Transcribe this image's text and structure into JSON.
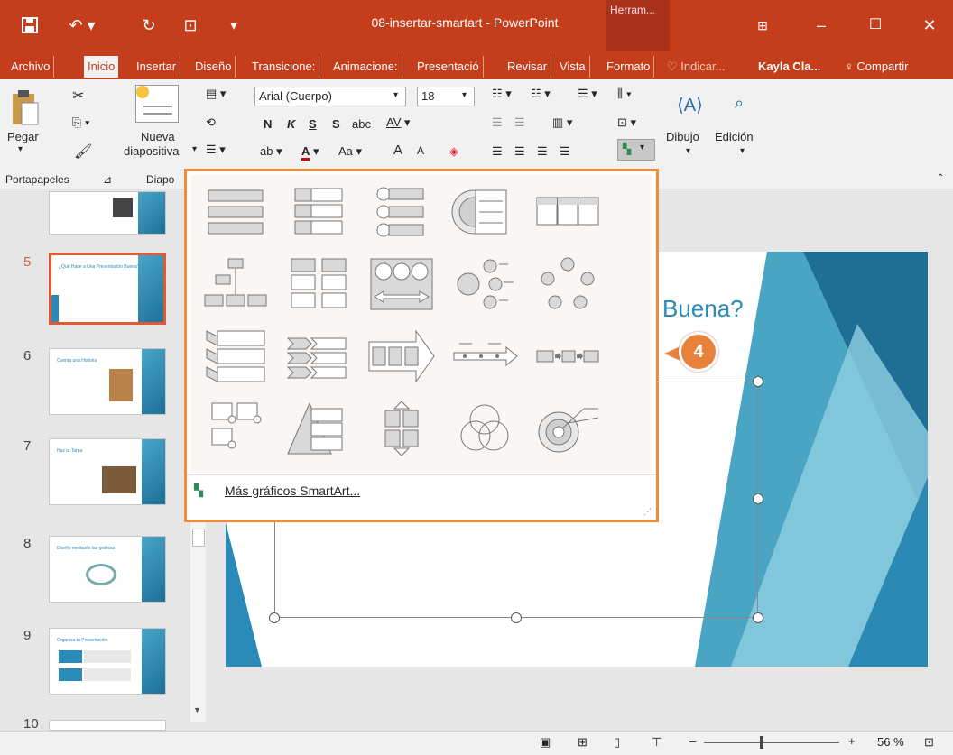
{
  "titlebar": {
    "title": "08-insertar-smartart  -  PowerPoint",
    "contextual_tab": "Herram...",
    "icons": [
      "save-icon",
      "undo-icon",
      "redo-icon",
      "start-presentation-icon",
      "customize-icon",
      "ribbon-display-icon",
      "minimize-icon",
      "maximize-icon",
      "close-icon"
    ]
  },
  "tabs": [
    "Archivo",
    "Inicio",
    "Insertar",
    "Diseño",
    "Transicione:",
    "Animacione:",
    "Presentació",
    "Revisar",
    "Vista",
    "Formato"
  ],
  "tabs_active": "Inicio",
  "tell_me": "Indicar...",
  "user": "Kayla Cla...",
  "share": "Compartir",
  "ribbon": {
    "paste": "Pegar",
    "new_slide_1": "Nueva",
    "new_slide_2": "diapositiva",
    "font_name": "Arial (Cuerpo)",
    "font_size": "18",
    "bold": "N",
    "italic": "K",
    "underline": "S",
    "shadow": "S",
    "strike": "abc",
    "spacing": "AV",
    "font_color": "A",
    "case": "Aa",
    "grow": "A",
    "shrink": "A",
    "draw": "Dibujo",
    "edit": "Edición",
    "group_clipboard": "Portapapeles",
    "group_slides": "Diapo"
  },
  "slides": [
    {
      "num": "5",
      "title": "¿Qué Hace a Una Presentación Buena?",
      "selected": true
    },
    {
      "num": "6",
      "title": "Cuenta una Historia"
    },
    {
      "num": "7",
      "title": "Haz tu Tarea"
    },
    {
      "num": "8",
      "title": "Diseño mediante las gráficas"
    },
    {
      "num": "9",
      "title": "Organiza tu Presentación"
    },
    {
      "num": "10",
      "title": ""
    }
  ],
  "slide_visible_text": "Buena?",
  "gallery": {
    "more_label": "Más gráficos SmartArt..."
  },
  "callout": "4",
  "status": {
    "zoom": "56 %"
  },
  "colors": {
    "accent": "#c43e1c",
    "callout": "#e8823a",
    "gallery_border": "#ee8c3a"
  }
}
